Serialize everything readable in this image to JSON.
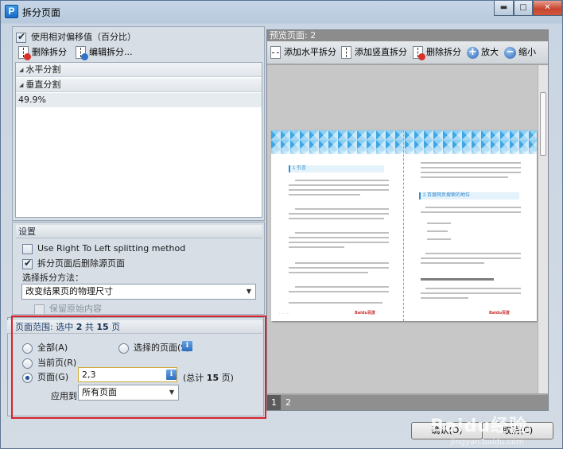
{
  "window": {
    "title": "拆分页面",
    "icon_letter": "P",
    "controls": [
      "minimize",
      "maximize",
      "close"
    ]
  },
  "left": {
    "use_relative_offset": {
      "label": "使用相对偏移值（百分比）",
      "checked": true
    },
    "toolbar": {
      "delete_split": "删除拆分",
      "edit_split": "编辑拆分..."
    },
    "split_list": {
      "groups": [
        {
          "label": "水平分割",
          "items": []
        },
        {
          "label": "垂直分割",
          "items": [
            "49.9%"
          ]
        }
      ]
    },
    "settings": {
      "header": "设置",
      "rtl": {
        "label": "Use Right To Left splitting method",
        "checked": false
      },
      "delete_source": {
        "label": "拆分页面后删除源页面",
        "checked": true
      },
      "method_label": "选择拆分方法：",
      "method_value": "改变结果页的物理尺寸",
      "keep_content": {
        "label": "保留原始内容",
        "checked": false,
        "disabled": true
      }
    },
    "page_range": {
      "header_prefix": "页面范围: 选中",
      "selected_count": "2",
      "header_mid": "共",
      "total_count": "15",
      "header_suffix": "页",
      "all": {
        "label": "全部(A)",
        "selected": false
      },
      "selected_pages": {
        "label": "选择的页面(S)",
        "selected": false
      },
      "current": {
        "label": "当前页(R)",
        "selected": false
      },
      "pages": {
        "label": "页面(G)",
        "selected": true,
        "value": "2,3"
      },
      "total_prefix": "(总计",
      "total_value": "15",
      "total_suffix": "页)",
      "apply_label": "应用到:",
      "apply_value": "所有页面"
    }
  },
  "preview": {
    "title": "预览页面: 2",
    "toolbar": {
      "add_horizontal": "添加水平拆分",
      "add_vertical": "添加竖直拆分",
      "delete_split": "删除拆分",
      "zoom_in": "放大",
      "zoom_out": "缩小"
    },
    "page_tabs": [
      "1",
      "2"
    ],
    "active_tab": "1",
    "doc": {
      "heading_left": "1 引言",
      "heading_right": "2 百度网页搜索的地位",
      "subheading_right": "2.1 百度网页搜索行业——内容质量",
      "footer_logo": "Baidu百度"
    }
  },
  "buttons": {
    "ok": "确认(O)",
    "cancel": "取消(C)"
  },
  "watermark": {
    "main": "Baidu经验",
    "sub": "jingyan.baidu.com"
  },
  "colors": {
    "highlight_border": "#d8232a",
    "accent": "#2d6ec0"
  }
}
